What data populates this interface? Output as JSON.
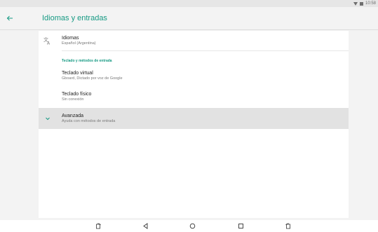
{
  "status_bar": {
    "time": "10:58"
  },
  "app_bar": {
    "title": "Idiomas y entradas",
    "back_icon": "arrow-back-icon"
  },
  "preferences": {
    "languages": {
      "icon": "translate-icon",
      "title": "Idiomas",
      "summary": "Español (Argentina)"
    },
    "category_label": "Teclado y métodos de entrada",
    "virtual_keyboard": {
      "title": "Teclado virtual",
      "summary": "Gboard, Dictado por voz de Google"
    },
    "physical_keyboard": {
      "title": "Teclado físico",
      "summary": "Sin conexión"
    },
    "advanced": {
      "icon": "chevron-down-icon",
      "title": "Avanzada",
      "summary": "Ayuda con métodos de entrada"
    }
  },
  "nav_bar": {
    "buttons": [
      "rotate-icon",
      "back-triangle-icon",
      "home-circle-icon",
      "recents-square-icon",
      "rotate-icon"
    ]
  },
  "colors": {
    "accent": "#169a83",
    "background": "#f3f3f3",
    "card": "#ffffff",
    "highlight": "#e2e2e2"
  }
}
